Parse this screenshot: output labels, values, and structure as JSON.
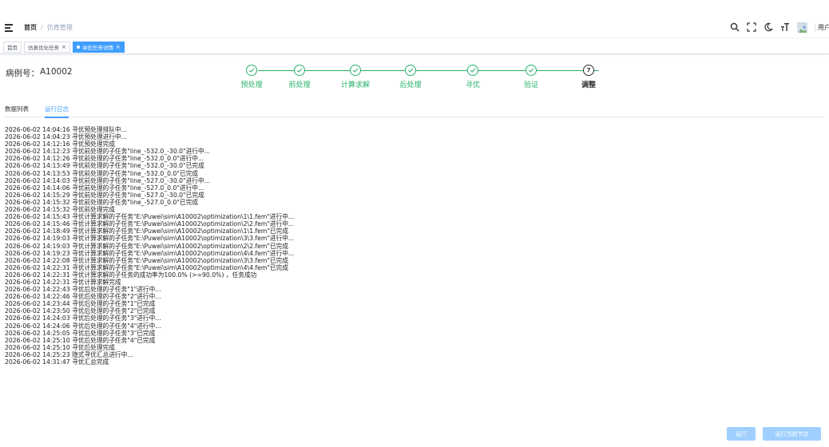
{
  "header": {
    "breadcrumb": {
      "home": "首页",
      "separator": "/",
      "current": "仿真管理"
    },
    "user_name": "用户",
    "icons": [
      "search-icon",
      "fullscreen-icon",
      "theme-icon",
      "font-size-icon",
      "avatar"
    ]
  },
  "tags": [
    {
      "label": "首页",
      "active": false,
      "closable": false
    },
    {
      "label": "仿真优化任务",
      "active": false,
      "closable": true
    },
    {
      "label": "寻优任务详情",
      "active": true,
      "closable": true
    }
  ],
  "case": {
    "label": "病例号：",
    "value": "A10002"
  },
  "steps": [
    {
      "label": "预处理",
      "status": "done"
    },
    {
      "label": "前处理",
      "status": "done"
    },
    {
      "label": "计算求解",
      "status": "done"
    },
    {
      "label": "后处理",
      "status": "done"
    },
    {
      "label": "寻优",
      "status": "done"
    },
    {
      "label": "验证",
      "status": "done"
    },
    {
      "label": "调整",
      "status": "current",
      "number": "7"
    }
  ],
  "tabs": [
    {
      "label": "数据列表",
      "active": false
    },
    {
      "label": "运行日志",
      "active": true
    }
  ],
  "log": [
    "2026-06-02 14:04:16 寻优预处理排队中...",
    "2026-06-02 14:04:23 寻优预处理进行中...",
    "2026-06-02 14:12:16 寻优预处理完成",
    "2026-06-02 14:12:23 寻优前处理的子任务\"line_-532.0_-30.0\"进行中...",
    "2026-06-02 14:12:26 寻优前处理的子任务\"line_-532.0_0.0\"进行中...",
    "2026-06-02 14:13:49 寻优前处理的子任务\"line_-532.0_-30.0\"已完成",
    "2026-06-02 14:13:53 寻优前处理的子任务\"line_-532.0_0.0\"已完成",
    "2026-06-02 14:14:03 寻优前处理的子任务\"line_-527.0_-30.0\"进行中...",
    "2026-06-02 14:14:06 寻优前处理的子任务\"line_-527.0_0.0\"进行中...",
    "2026-06-02 14:15:29 寻优前处理的子任务\"line_-527.0_-30.0\"已完成",
    "2026-06-02 14:15:32 寻优前处理的子任务\"line_-527.0_0.0\"已完成",
    "2026-06-02 14:15:32 寻优前处理完成",
    "2026-06-02 14:15:43 寻优计算求解的子任务\"E:\\Puwei\\sim\\A10002\\optimization\\1\\1.fem\"进行中...",
    "2026-06-02 14:15:46 寻优计算求解的子任务\"E:\\Puwei\\sim\\A10002\\optimization\\2\\2.fem\"进行中...",
    "2026-06-02 14:18:49 寻优计算求解的子任务\"E:\\Puwei\\sim\\A10002\\optimization\\1\\1.fem\"已完成",
    "2026-06-02 14:19:03 寻优计算求解的子任务\"E:\\Puwei\\sim\\A10002\\optimization\\3\\3.fem\"进行中...",
    "2026-06-02 14:19:03 寻优计算求解的子任务\"E:\\Puwei\\sim\\A10002\\optimization\\2\\2.fem\"已完成",
    "2026-06-02 14:19:23 寻优计算求解的子任务\"E:\\Puwei\\sim\\A10002\\optimization\\4\\4.fem\"进行中...",
    "2026-06-02 14:22:08 寻优计算求解的子任务\"E:\\Puwei\\sim\\A10002\\optimization\\3\\3.fem\"已完成",
    "2026-06-02 14:22:31 寻优计算求解的子任务\"E:\\Puwei\\sim\\A10002\\optimization\\4\\4.fem\"已完成",
    "2026-06-02 14:22:31 寻优计算求解的子任务的成功率为100.0% (>=90.0%) ，任务成功",
    "2026-06-02 14:22:31 寻优计算求解完成",
    "2026-06-02 14:22:43 寻优后处理的子任务\"1\"进行中...",
    "2026-06-02 14:22:46 寻优后处理的子任务\"2\"进行中...",
    "2026-06-02 14:23:44 寻优后处理的子任务\"1\"已完成",
    "2026-06-02 14:23:50 寻优后处理的子任务\"2\"已完成",
    "2026-06-02 14:24:03 寻优后处理的子任务\"3\"进行中...",
    "2026-06-02 14:24:06 寻优后处理的子任务\"4\"进行中...",
    "2026-06-02 14:25:05 寻优后处理的子任务\"3\"已完成",
    "2026-06-02 14:25:10 寻优后处理的子任务\"4\"已完成",
    "2026-06-02 14:25:10 寻优后处理完成",
    "2026-06-02 14:25:23 隐式寻优汇总进行中...",
    "2026-06-02 14:31:47 寻优汇总完成"
  ],
  "buttons": {
    "run": "运行",
    "run_current_node": "运行当前节点"
  },
  "colors": {
    "accent": "#409eff",
    "success": "#2ab26b",
    "disabled_button": "#a0cfff"
  }
}
